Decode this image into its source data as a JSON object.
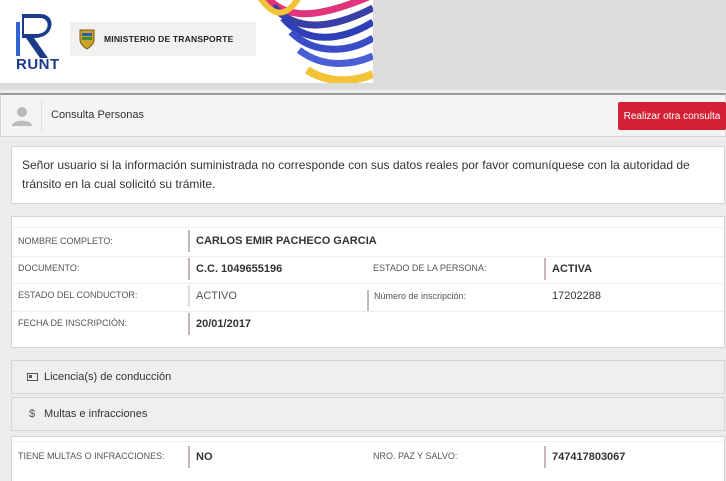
{
  "header": {
    "runt_text": "RUNT",
    "ministerio": "MINISTERIO DE TRANSPORTE"
  },
  "topbar": {
    "title": "Consulta Personas",
    "button": "Realizar otra consulta"
  },
  "notice": "Señor usuario si la información suministrada no corresponde con sus datos reales por favor comuníquese con la autoridad de tránsito en la cual solicitó su trámite.",
  "person": {
    "nombre_label": "NOMBRE COMPLETO:",
    "nombre_value": "CARLOS EMIR PACHECO GARCIA",
    "documento_label": "DOCUMENTO:",
    "documento_value": "C.C. 1049655196",
    "estado_persona_label": "ESTADO DE LA PERSONA:",
    "estado_persona_value": "ACTIVA",
    "estado_conductor_label": "ESTADO DEL CONDUCTOR:",
    "estado_conductor_value": "ACTIVO",
    "num_inscripcion_label": "Número de inscripción:",
    "num_inscripcion_value": "17202288",
    "fecha_label": "FECHA DE INSCRIPCIÓN:",
    "fecha_value": "20/01/2017"
  },
  "sections": {
    "licencias": "Licencia(s) de conducción",
    "multas": "Multas e infracciones"
  },
  "multas": {
    "tiene_label": "TIENE MULTAS O INFRACCIONES:",
    "tiene_value": "NO",
    "paz_label": "NRO. PAZ Y SALVO:",
    "paz_value": "747417803067"
  },
  "colors": {
    "accent_red": "#d32034",
    "runt_blue": "#1b3a8a"
  }
}
